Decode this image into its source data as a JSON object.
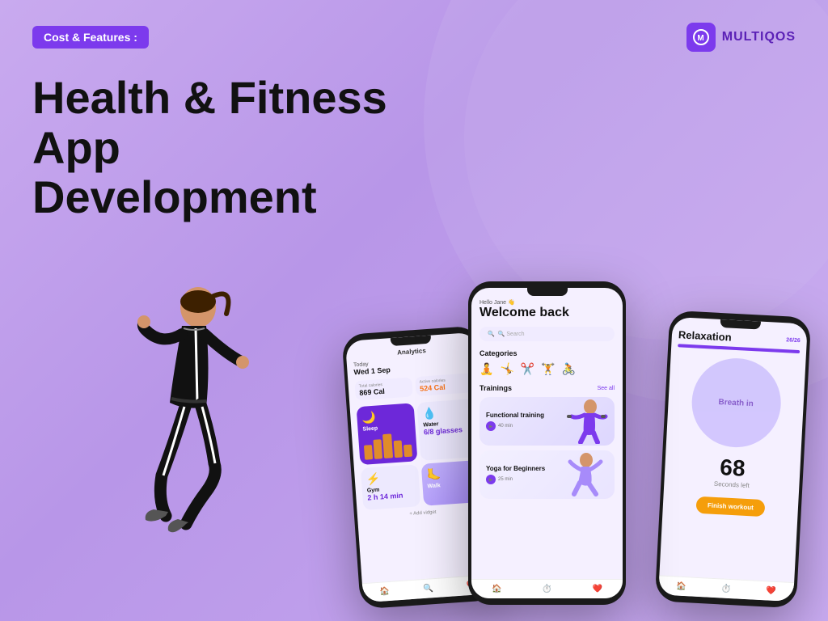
{
  "background": {
    "color": "#c5a8f0"
  },
  "badge": {
    "text": "Cost & Features :"
  },
  "logo": {
    "text": "MULTIQOS",
    "icon": "M"
  },
  "heading": {
    "line1": "Health & Fitness App",
    "line2": "Development"
  },
  "phone_left": {
    "title": "Analytics",
    "date_day": "Today",
    "date_full": "Wed 1 Sep",
    "total_cal_label": "Total calories",
    "total_cal_value": "869 Cal",
    "active_cal_label": "Active calories",
    "active_cal_value": "524 Cal",
    "sleep_label": "Sleep",
    "water_label": "Water",
    "water_val": "6/8 glasses",
    "gym_label": "Gym",
    "gym_val": "2 h 14 min",
    "walk_label": "Walk",
    "add_widget": "+ Add vidget",
    "nav": [
      "🏠",
      "🔍",
      "❤️"
    ]
  },
  "phone_center": {
    "hello": "Hello Jane 👋",
    "welcome": "Welcome back",
    "search_placeholder": "🔍 Search",
    "categories_label": "Categories",
    "categories": [
      "🧘",
      "🤸",
      "✂️",
      "🏋️",
      "🚴"
    ],
    "trainings_label": "Trainings",
    "see_all": "See all",
    "trainings": [
      {
        "name": "Functional training",
        "duration": "40 min",
        "emoji": "🏋️"
      },
      {
        "name": "Yoga for Beginners",
        "duration": "25 min",
        "emoji": "🧘"
      }
    ],
    "nav": [
      "🏠",
      "⏱️",
      "❤️"
    ]
  },
  "phone_right": {
    "title": "Relaxation",
    "progress": "26/26",
    "progress_pct": 100,
    "breath_text": "Breath in",
    "seconds_num": "68",
    "seconds_label": "Seconds left",
    "finish_btn": "Finish workout",
    "nav": [
      "🏠",
      "⏱️",
      "❤️"
    ]
  }
}
